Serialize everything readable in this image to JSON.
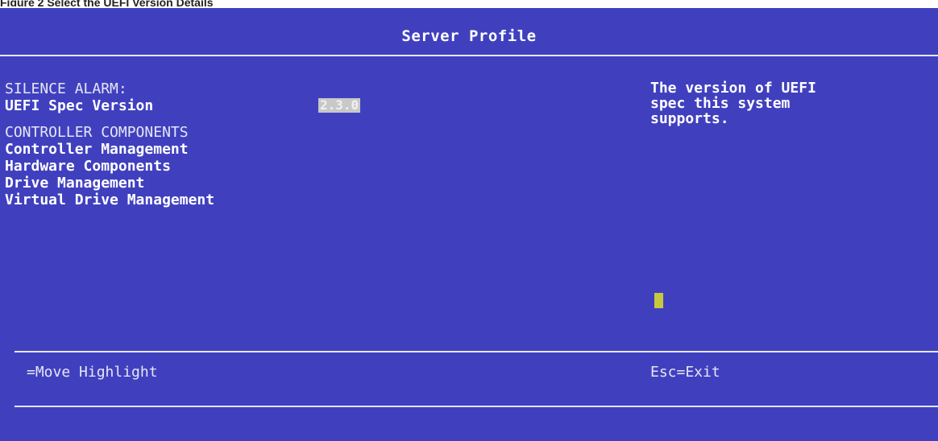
{
  "caption": "Figure 2 Select the UEFI Version Details",
  "screen": {
    "title": "Server Profile",
    "items": [
      {
        "label": "SILENCE ALARM:",
        "style": "plain"
      },
      {
        "label": "UEFI Spec Version",
        "style": "bold",
        "value": "2.3.0"
      },
      {
        "label": "CONTROLLER COMPONENTS",
        "style": "plain"
      },
      {
        "label": "Controller Management",
        "style": "bold"
      },
      {
        "label": "Hardware Components",
        "style": "bold"
      },
      {
        "label": "Drive Management",
        "style": "bold"
      },
      {
        "label": "Virtual Drive Management",
        "style": "bold"
      }
    ],
    "help_lines": [
      "The version of UEFI",
      "spec this system",
      "supports."
    ],
    "footer": {
      "left": "=Move Highlight",
      "right": "Esc=Exit"
    }
  },
  "colors": {
    "background": "#4040bf",
    "text": "#ffffff",
    "value_highlight": "#c8c8c8",
    "cursor": "#c8c840"
  }
}
